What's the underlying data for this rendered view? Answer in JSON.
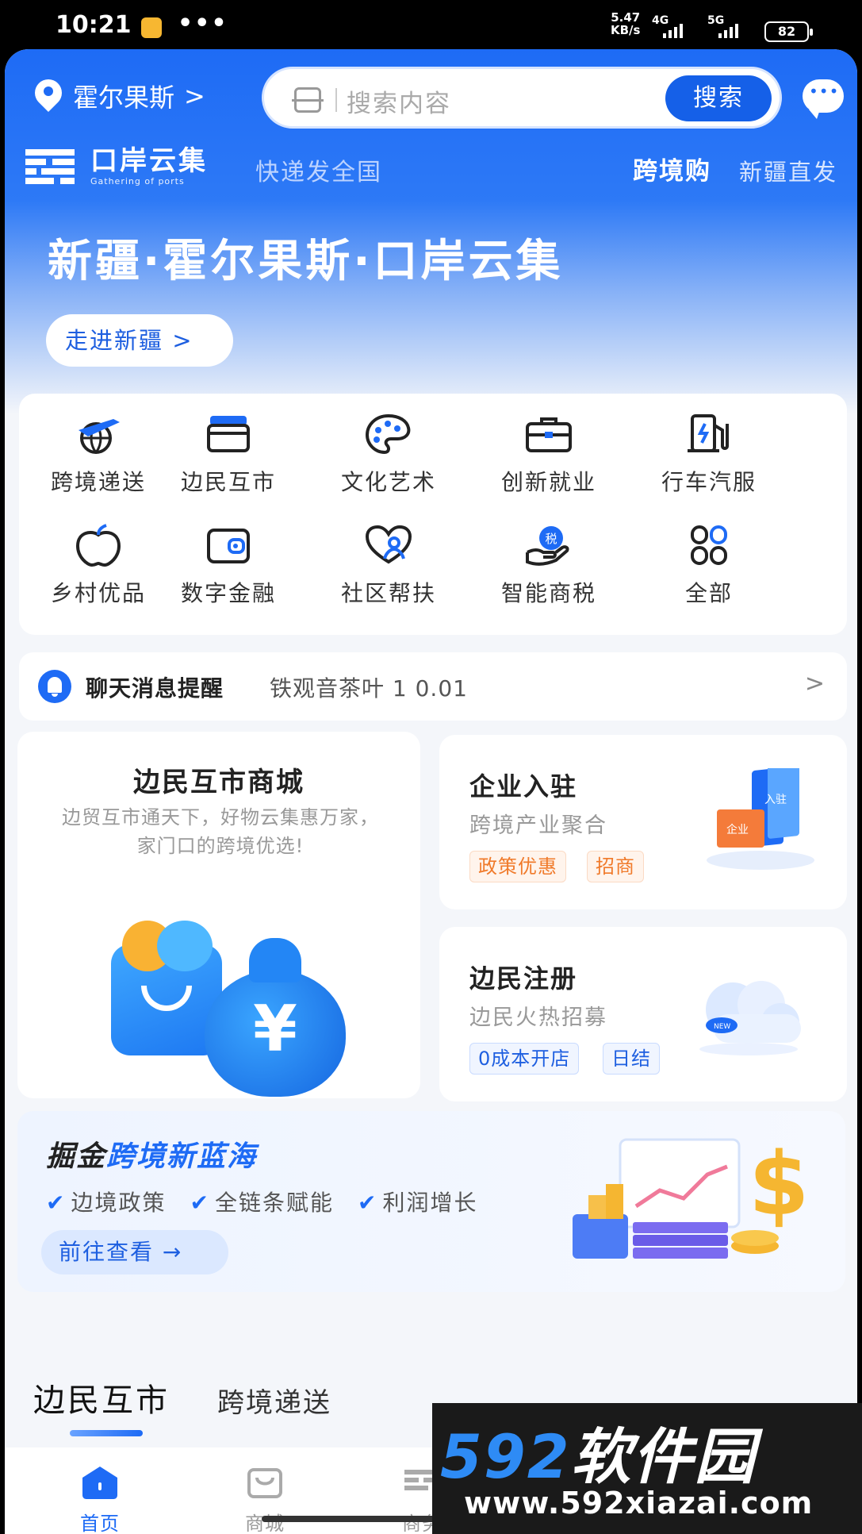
{
  "status_bar": {
    "time": "10:21",
    "dots": "•••",
    "speed_value": "5.47",
    "speed_unit": "KB/s",
    "net1": "4G",
    "net2": "5G",
    "battery": "82"
  },
  "header": {
    "location": "霍尔果斯",
    "search_placeholder": "搜索内容",
    "search_button": "搜索",
    "logo_cn": "口岸云集",
    "logo_en": "Gathering of ports",
    "slogan": "快递发全国",
    "cross_border": "跨境购",
    "xinjiang_direct": "新疆直发"
  },
  "hero": {
    "title": "新疆·霍尔果斯·口岸云集",
    "enter_button": "走进新疆"
  },
  "grid": [
    {
      "label": "跨境递送",
      "icon": "plane-globe-icon"
    },
    {
      "label": "边民互市",
      "icon": "storefront-icon"
    },
    {
      "label": "文化艺术",
      "icon": "palette-icon"
    },
    {
      "label": "创新就业",
      "icon": "briefcase-icon"
    },
    {
      "label": "行车汽服",
      "icon": "fuel-pump-icon"
    },
    {
      "label": "乡村优品",
      "icon": "apple-icon"
    },
    {
      "label": "数字金融",
      "icon": "wallet-icon"
    },
    {
      "label": "社区帮扶",
      "icon": "heart-person-icon"
    },
    {
      "label": "智能商税",
      "icon": "tax-hand-icon"
    },
    {
      "label": "全部",
      "icon": "all-grid-icon"
    }
  ],
  "notice": {
    "title": "聊天消息提醒",
    "text": "铁观音茶叶 1 0.01"
  },
  "mall": {
    "title": "边民互市商城",
    "desc": "边贸互市通天下，好物云集惠万家， 家门口的跨境优选!",
    "yuan": "¥",
    "slide_total": 3,
    "slide_active": 3
  },
  "enterprise": {
    "title": "企业入驻",
    "subtitle": "跨境产业聚合",
    "tags": [
      "政策优惠",
      "招商"
    ],
    "art_front": "企业",
    "art_back": "入驻"
  },
  "register": {
    "title": "边民注册",
    "subtitle": "边民火热招募",
    "tags": [
      "0成本开店",
      "日结"
    ],
    "art_badge": "NEW"
  },
  "banner": {
    "title_dark": "掘金",
    "title_blue": "跨境新蓝海",
    "points": [
      "边境政策",
      "全链条赋能",
      "利润增长"
    ],
    "button": "前往查看",
    "check": "✔",
    "arrow": "→"
  },
  "tabs": {
    "active": "边民互市",
    "other": "跨境递送"
  },
  "bottom_nav": [
    {
      "label": "首页",
      "active": true
    },
    {
      "label": "商城",
      "active": false
    },
    {
      "label": "商务",
      "active": false
    }
  ],
  "watermark": {
    "number": "592",
    "name": "软件园",
    "url": "www.592xiazai.com"
  },
  "colors": {
    "primary": "#1e6bf5",
    "orange": "#f07a2a",
    "background": "#f4f6fa"
  }
}
